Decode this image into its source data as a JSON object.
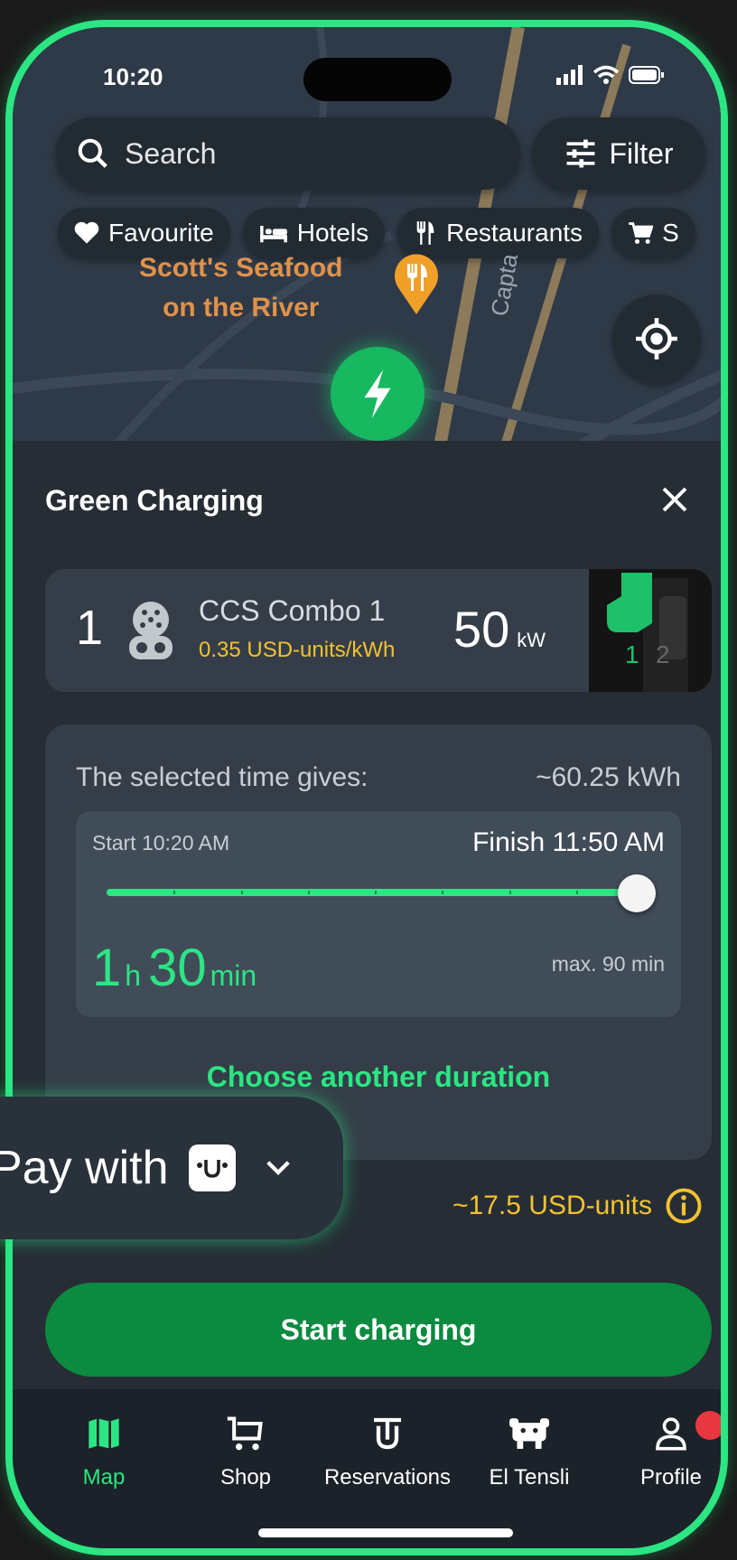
{
  "status": {
    "time": "10:20"
  },
  "search": {
    "placeholder": "Search"
  },
  "filter": {
    "label": "Filter"
  },
  "chips": [
    {
      "label": "Favourite",
      "icon": "heart-icon"
    },
    {
      "label": "Hotels",
      "icon": "bed-icon"
    },
    {
      "label": "Restaurants",
      "icon": "fork-knife-icon"
    },
    {
      "label": "S",
      "icon": "cart-icon"
    }
  ],
  "map": {
    "poi_line1": "Scott's Seafood",
    "poi_line2": "on the River",
    "street": "Capta"
  },
  "sheet": {
    "title": "Green Charging",
    "connector": {
      "number": "1",
      "name": "CCS Combo 1",
      "price": "0.35 USD-units/kWh",
      "power": "50",
      "power_unit": "kW"
    },
    "selection": {
      "gives_label": "The selected time gives:",
      "gives_value": "~60.25 kWh",
      "start_label": "Start 10:20 AM",
      "finish_label": "Finish 11:50 AM",
      "duration_hours": "1",
      "duration_hours_unit": "h",
      "duration_minutes": "30",
      "duration_minutes_unit": "min",
      "max_label": "max. 90 min",
      "slider_fraction": 1.0
    },
    "choose_label": "Choose another duration",
    "estimate": "~17.5 USD-units",
    "start_button": "Start charging"
  },
  "pay": {
    "label": "Pay with"
  },
  "tabs": [
    {
      "label": "Map",
      "icon": "map-icon",
      "active": true
    },
    {
      "label": "Shop",
      "icon": "cart-icon"
    },
    {
      "label": "Reservations",
      "icon": "reservations-icon"
    },
    {
      "label": "El Tensli",
      "icon": "tensli-icon"
    },
    {
      "label": "Profile",
      "icon": "profile-icon",
      "badge": true
    }
  ],
  "colors": {
    "accent": "#2be683",
    "primary_button": "#0b8a40",
    "price": "#f2c230",
    "badge": "#e8383f"
  }
}
